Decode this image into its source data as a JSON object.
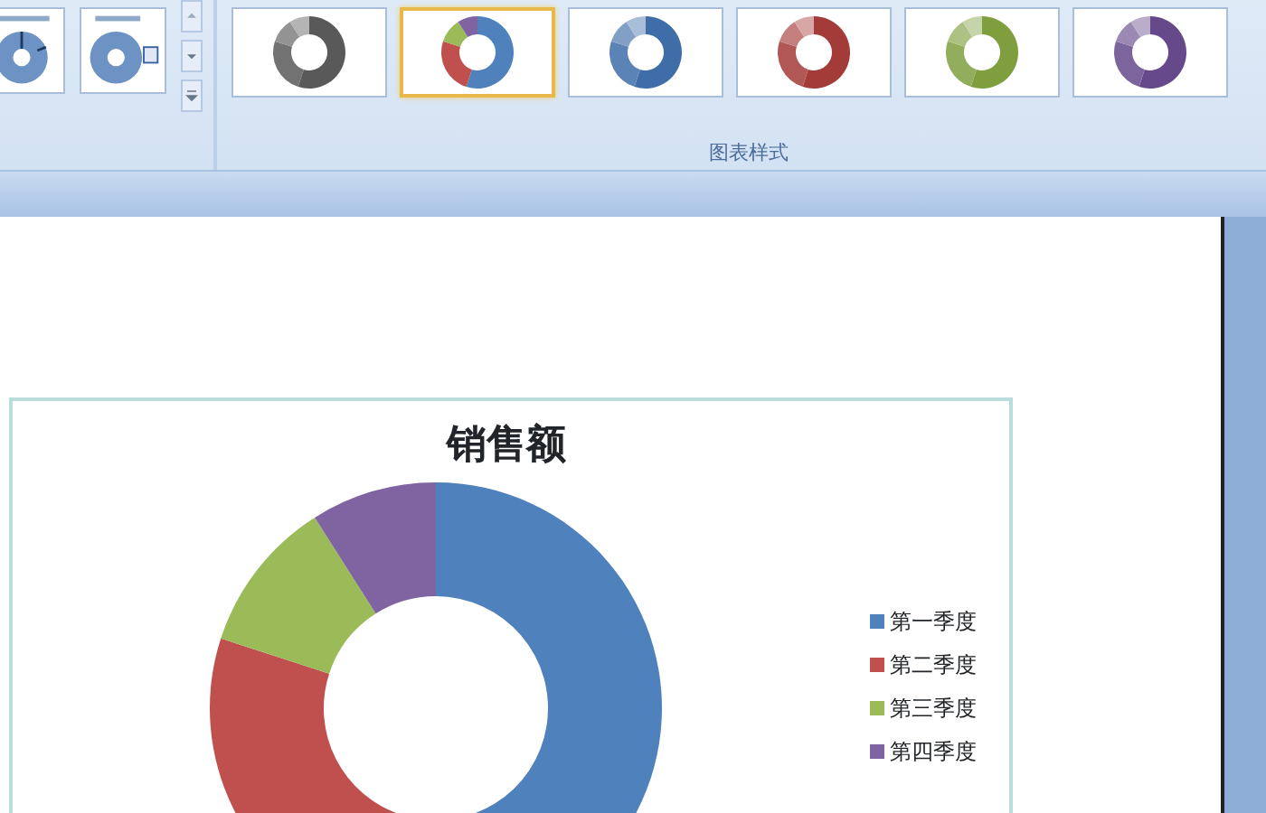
{
  "chart_styles": [
    {
      "kind": "mono",
      "color": "#595959",
      "selected": false
    },
    {
      "kind": "multi",
      "selected": true
    },
    {
      "kind": "mono",
      "color": "#3e6da8",
      "selected": false
    },
    {
      "kind": "mono",
      "color": "#a33b38",
      "selected": false
    },
    {
      "kind": "mono",
      "color": "#7f9f3f",
      "selected": false
    },
    {
      "kind": "mono",
      "color": "#65498a",
      "selected": false
    }
  ],
  "group_label": "图表样式",
  "chart": {
    "title": "销售额",
    "legend": [
      {
        "label": "第一季度",
        "color": "#4f81bd"
      },
      {
        "label": "第二季度",
        "color": "#c0504d"
      },
      {
        "label": "第三季度",
        "color": "#9bbb59"
      },
      {
        "label": "第四季度",
        "color": "#8064a2"
      }
    ]
  }
}
